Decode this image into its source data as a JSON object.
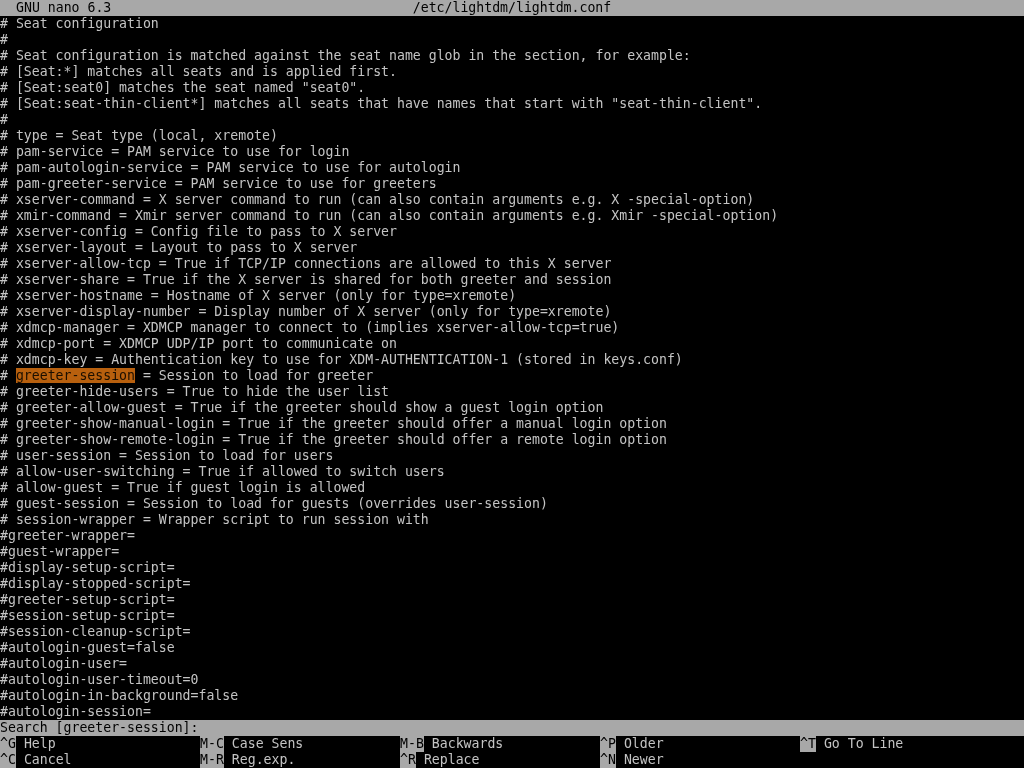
{
  "title_bar": {
    "app": "GNU nano 6.3",
    "file": "/etc/lightdm/lightdm.conf"
  },
  "lines": [
    {
      "text": "# Seat configuration"
    },
    {
      "text": "#"
    },
    {
      "text": "# Seat configuration is matched against the seat name glob in the section, for example:"
    },
    {
      "text": "# [Seat:*] matches all seats and is applied first."
    },
    {
      "text": "# [Seat:seat0] matches the seat named \"seat0\"."
    },
    {
      "text": "# [Seat:seat-thin-client*] matches all seats that have names that start with \"seat-thin-client\"."
    },
    {
      "text": "#"
    },
    {
      "text": "# type = Seat type (local, xremote)"
    },
    {
      "text": "# pam-service = PAM service to use for login"
    },
    {
      "text": "# pam-autologin-service = PAM service to use for autologin"
    },
    {
      "text": "# pam-greeter-service = PAM service to use for greeters"
    },
    {
      "text": "# xserver-command = X server command to run (can also contain arguments e.g. X -special-option)"
    },
    {
      "text": "# xmir-command = Xmir server command to run (can also contain arguments e.g. Xmir -special-option)"
    },
    {
      "text": "# xserver-config = Config file to pass to X server"
    },
    {
      "text": "# xserver-layout = Layout to pass to X server"
    },
    {
      "text": "# xserver-allow-tcp = True if TCP/IP connections are allowed to this X server"
    },
    {
      "text": "# xserver-share = True if the X server is shared for both greeter and session"
    },
    {
      "text": "# xserver-hostname = Hostname of X server (only for type=xremote)"
    },
    {
      "text": "# xserver-display-number = Display number of X server (only for type=xremote)"
    },
    {
      "text": "# xdmcp-manager = XDMCP manager to connect to (implies xserver-allow-tcp=true)"
    },
    {
      "text": "# xdmcp-port = XDMCP UDP/IP port to communicate on"
    },
    {
      "text": "# xdmcp-key = Authentication key to use for XDM-AUTHENTICATION-1 (stored in keys.conf)"
    },
    {
      "text": "# ",
      "match": "greeter-session",
      "after": " = Session to load for greeter"
    },
    {
      "text": "# greeter-hide-users = True to hide the user list"
    },
    {
      "text": "# greeter-allow-guest = True if the greeter should show a guest login option"
    },
    {
      "text": "# greeter-show-manual-login = True if the greeter should offer a manual login option"
    },
    {
      "text": "# greeter-show-remote-login = True if the greeter should offer a remote login option"
    },
    {
      "text": "# user-session = Session to load for users"
    },
    {
      "text": "# allow-user-switching = True if allowed to switch users"
    },
    {
      "text": "# allow-guest = True if guest login is allowed"
    },
    {
      "text": "# guest-session = Session to load for guests (overrides user-session)"
    },
    {
      "text": "# session-wrapper = Wrapper script to run session with"
    },
    {
      "text": "#greeter-wrapper="
    },
    {
      "text": "#guest-wrapper="
    },
    {
      "text": "#display-setup-script="
    },
    {
      "text": "#display-stopped-script="
    },
    {
      "text": "#greeter-setup-script="
    },
    {
      "text": "#session-setup-script="
    },
    {
      "text": "#session-cleanup-script="
    },
    {
      "text": "#autologin-guest=false"
    },
    {
      "text": "#autologin-user="
    },
    {
      "text": "#autologin-user-timeout=0"
    },
    {
      "text": "#autologin-in-background=false"
    },
    {
      "text": "#autologin-session="
    }
  ],
  "search_prompt": "Search [greeter-session]:",
  "shortcuts": [
    [
      {
        "key": "^G",
        "label": "Help"
      },
      {
        "key": "M-C",
        "label": "Case Sens"
      },
      {
        "key": "M-B",
        "label": "Backwards"
      },
      {
        "key": "^P",
        "label": "Older"
      },
      {
        "key": "^T",
        "label": "Go To Line"
      }
    ],
    [
      {
        "key": "^C",
        "label": "Cancel"
      },
      {
        "key": "M-R",
        "label": "Reg.exp."
      },
      {
        "key": "^R",
        "label": "Replace"
      },
      {
        "key": "^N",
        "label": "Newer"
      }
    ]
  ]
}
